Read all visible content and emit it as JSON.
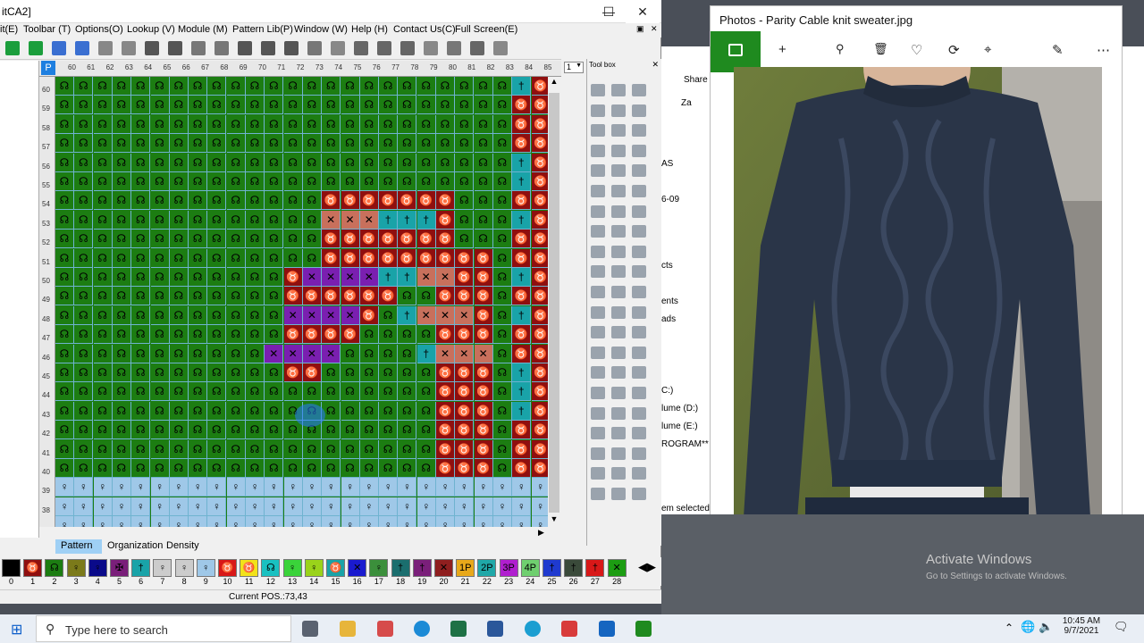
{
  "knit_window": {
    "title": "itCA2]",
    "menu": [
      "it(E)",
      "Toolbar (T)",
      "Options(O)",
      "Lookup (V)",
      "Module (M)",
      "Pattern Lib(P)",
      "Window (W)",
      "Help (H)",
      "Contact Us(C)",
      "Full Screen(E)"
    ],
    "pattern_box": "P",
    "column_numbers": [
      "60",
      "61",
      "62",
      "63",
      "64",
      "65",
      "66",
      "67",
      "68",
      "69",
      "70",
      "71",
      "72",
      "73",
      "74",
      "75",
      "76",
      "77",
      "78",
      "79",
      "80",
      "81",
      "82",
      "83",
      "84",
      "85"
    ],
    "row_numbers": [
      "60",
      "59",
      "58",
      "57",
      "56",
      "55",
      "54",
      "53",
      "52",
      "51",
      "50",
      "49",
      "48",
      "47",
      "46",
      "45",
      "44",
      "43",
      "42",
      "41",
      "40",
      "39",
      "38"
    ],
    "zoom_value": "1",
    "toolbox_title": "Tool box",
    "tabs": [
      "Pattern",
      "Organization",
      "Density"
    ],
    "palette_numbers": [
      "0",
      "1",
      "2",
      "3",
      "4",
      "5",
      "6",
      "7",
      "8",
      "9",
      "10",
      "11",
      "12",
      "13",
      "14",
      "15",
      "16",
      "17",
      "18",
      "19",
      "20",
      "21",
      "22",
      "23",
      "24",
      "25",
      "26",
      "27",
      "28"
    ],
    "status": "Current POS.:73,43"
  },
  "explorer_sliver": {
    "share": "Share",
    "items": [
      "Za",
      "AS",
      "6-09",
      "cts",
      "ents",
      "ads",
      "C:)",
      "lume (D:)",
      "lume (E:)",
      "ROGRAM** (",
      "em selected"
    ]
  },
  "photos_window": {
    "title": "Photos - Parity Cable knit sweater.jpg"
  },
  "watermark": {
    "line1": "Activate Windows",
    "line2": "Go to Settings to activate Windows."
  },
  "taskbar": {
    "search_placeholder": "Type here to search",
    "time": "10:45 AM",
    "date": "9/7/2021"
  },
  "colors": {
    "green": "#1c7d12",
    "red": "#8f0f0f",
    "purple": "#7a1fb0",
    "teal": "#19a3a8",
    "salmon": "#c8705c",
    "lightblue": "#9fc8e8",
    "brand_green": "#1f8a1f"
  },
  "cursor_position": "73,43"
}
